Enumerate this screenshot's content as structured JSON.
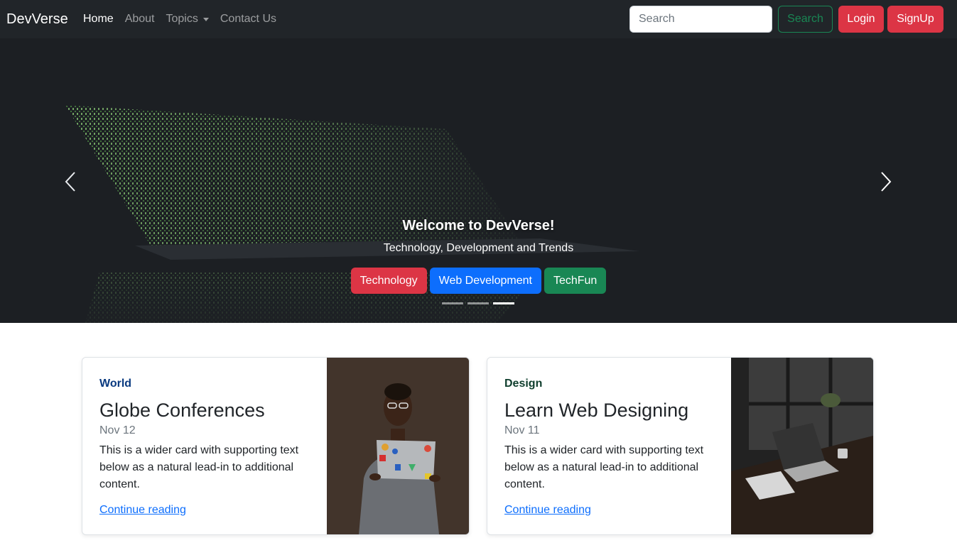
{
  "navbar": {
    "brand": "DevVerse",
    "links": [
      {
        "label": "Home"
      },
      {
        "label": "About"
      },
      {
        "label": "Topics"
      },
      {
        "label": "Contact Us"
      }
    ],
    "search": {
      "placeholder": "Search"
    },
    "search_button": "Search",
    "login_button": "Login",
    "signup_button": "SignUp"
  },
  "hero": {
    "title": "Welcome to DevVerse!",
    "subtitle": "Technology, Development and Trends",
    "buttons": [
      {
        "label": "Technology",
        "color": "#dc3545"
      },
      {
        "label": "Web Development",
        "color": "#0d6efd"
      },
      {
        "label": "TechFun",
        "color": "#198754"
      }
    ],
    "slides_total": 3,
    "active_slide": 3
  },
  "cards": [
    {
      "category": "World",
      "title": "Globe Conferences",
      "date": "Nov 12",
      "text": "This is a wider card with supporting text below as a natural lead-in to additional content.",
      "link": "Continue reading"
    },
    {
      "category": "Design",
      "title": "Learn Web Designing",
      "date": "Nov 11",
      "text": "This is a wider card with supporting text below as a natural lead-in to additional content.",
      "link": "Continue reading"
    }
  ],
  "colors": {
    "navbar_bg": "#212529",
    "danger": "#dc3545",
    "primary": "#0d6efd",
    "success": "#198754"
  }
}
